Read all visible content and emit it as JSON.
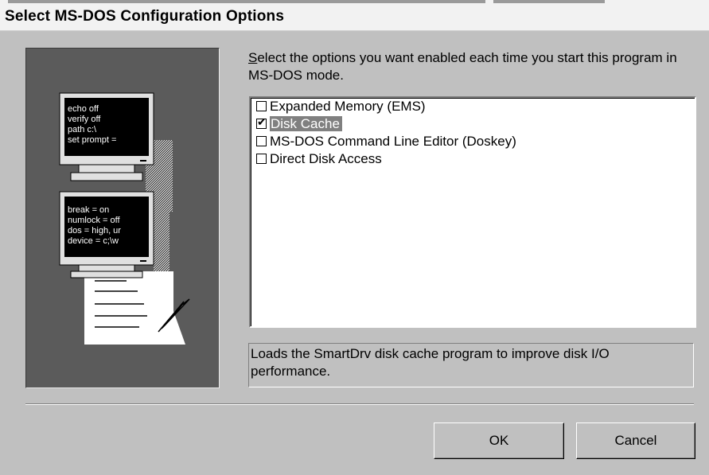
{
  "window": {
    "title": "Select MS-DOS Configuration Options"
  },
  "illustration": {
    "screen1_lines": [
      "echo off",
      "verify off",
      "path c:\\",
      "set prompt ="
    ],
    "screen2_lines": [
      "break = on",
      "numlock = off",
      "dos = high, ur",
      "device = c;\\w"
    ]
  },
  "prompt": {
    "hotkey": "S",
    "rest_line": "elect the options you want enabled each time you start this program in MS-DOS mode."
  },
  "options": [
    {
      "label": "Expanded Memory (EMS)",
      "checked": false,
      "selected": false
    },
    {
      "label": "Disk Cache",
      "checked": true,
      "selected": true
    },
    {
      "label": "MS-DOS Command Line Editor (Doskey)",
      "checked": false,
      "selected": false
    },
    {
      "label": "Direct Disk Access",
      "checked": false,
      "selected": false
    }
  ],
  "description": "Loads the SmartDrv disk cache program to improve disk I/O performance.",
  "buttons": {
    "ok": "OK",
    "cancel": "Cancel"
  },
  "colors": {
    "face": "#c0c0c0",
    "selection": "#808080",
    "art_background": "#5b5b5b"
  }
}
